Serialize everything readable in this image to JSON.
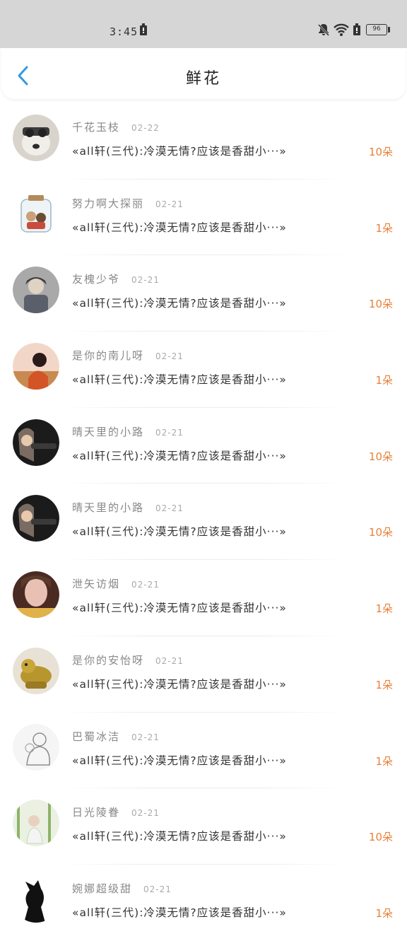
{
  "status_bar": {
    "time": "3:45",
    "battery": "96"
  },
  "header": {
    "title": "鲜花"
  },
  "list": [
    {
      "name": "千花玉枝",
      "date": "02-22",
      "book": "«all轩(三代):冷漠无情?应该是香甜小···»",
      "count": "10朵",
      "avatar_colors": [
        "#d8d4cc",
        "#3b3b3b"
      ]
    },
    {
      "name": "努力啊大探丽",
      "date": "02-21",
      "book": "«all轩(三代):冷漠无情?应该是香甜小···»",
      "count": "1朵",
      "avatar_colors": [
        "#eef3f6",
        "#c9a07a"
      ]
    },
    {
      "name": "友槐少爷",
      "date": "02-21",
      "book": "«all轩(三代):冷漠无情?应该是香甜小···»",
      "count": "10朵",
      "avatar_colors": [
        "#a9a9a9",
        "#3c3c3c"
      ]
    },
    {
      "name": "是你的南儿呀",
      "date": "02-21",
      "book": "«all轩(三代):冷漠无情?应该是香甜小···»",
      "count": "1朵",
      "avatar_colors": [
        "#f2d7c8",
        "#d35427"
      ]
    },
    {
      "name": "晴天里的小路",
      "date": "02-21",
      "book": "«all轩(三代):冷漠无情?应该是香甜小···»",
      "count": "10朵",
      "avatar_colors": [
        "#7a6c63",
        "#1b1b1b"
      ]
    },
    {
      "name": "晴天里的小路",
      "date": "02-21",
      "book": "«all轩(三代):冷漠无情?应该是香甜小···»",
      "count": "10朵",
      "avatar_colors": [
        "#7a6c63",
        "#1b1b1b"
      ]
    },
    {
      "name": "泄矢访烟",
      "date": "02-21",
      "book": "«all轩(三代):冷漠无情?应该是香甜小···»",
      "count": "1朵",
      "avatar_colors": [
        "#e9c1b4",
        "#4a2a22"
      ]
    },
    {
      "name": "是你的安怡呀",
      "date": "02-21",
      "book": "«all轩(三代):冷漠无情?应该是香甜小···»",
      "count": "1朵",
      "avatar_colors": [
        "#e8e2d6",
        "#b8962e"
      ]
    },
    {
      "name": "巴蜀冰洁",
      "date": "02-21",
      "book": "«all轩(三代):冷漠无情?应该是香甜小···»",
      "count": "1朵",
      "avatar_colors": [
        "#f5f5f5",
        "#8d8d8d"
      ]
    },
    {
      "name": "日光陵眷",
      "date": "02-21",
      "book": "«all轩(三代):冷漠无情?应该是香甜小···»",
      "count": "10朵",
      "avatar_colors": [
        "#eaf1e3",
        "#8fb36a"
      ]
    },
    {
      "name": "婉娜超级甜",
      "date": "02-21",
      "book": "«all轩(三代):冷漠无情?应该是香甜小···»",
      "count": "1朵",
      "avatar_colors": [
        "#ffffff",
        "#111111"
      ]
    }
  ]
}
